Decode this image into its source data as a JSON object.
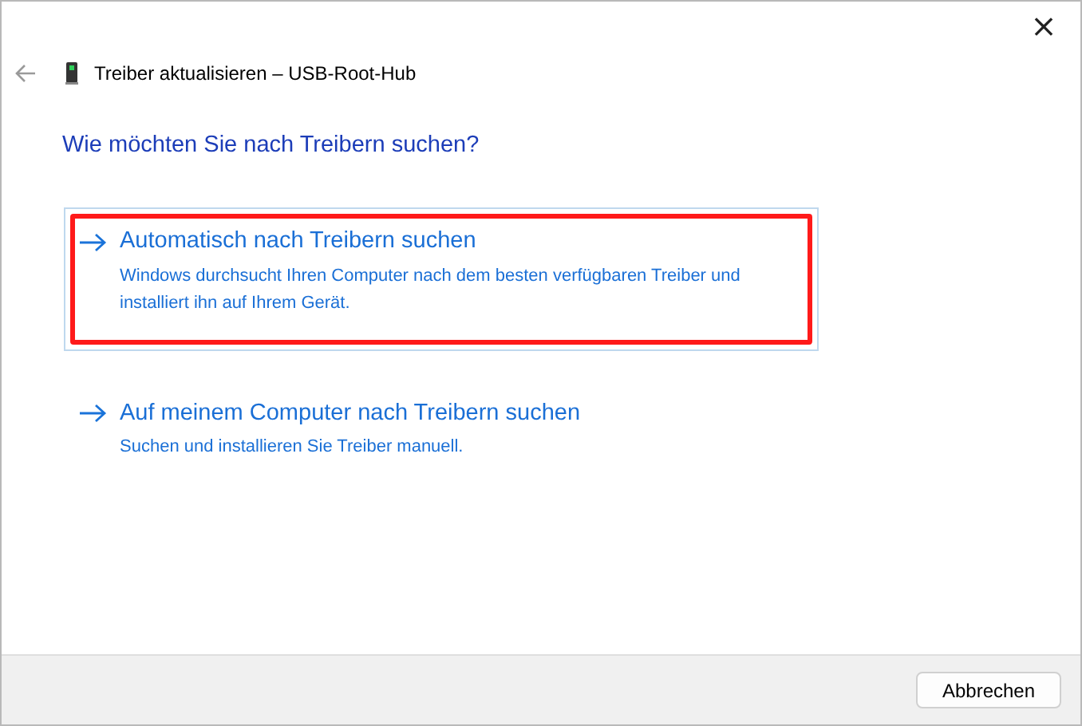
{
  "window": {
    "title": "Treiber aktualisieren – USB-Root-Hub",
    "close": "×"
  },
  "heading": "Wie möchten Sie nach Treibern suchen?",
  "options": [
    {
      "title": "Automatisch nach Treibern suchen",
      "description": "Windows durchsucht Ihren Computer nach dem besten verfügbaren Treiber und installiert ihn auf Ihrem Gerät.",
      "focused": true,
      "highlighted": true
    },
    {
      "title": "Auf meinem Computer nach Treibern suchen",
      "description": "Suchen und installieren Sie Treiber manuell.",
      "focused": false,
      "highlighted": false
    }
  ],
  "buttons": [
    "Abbrechen"
  ]
}
